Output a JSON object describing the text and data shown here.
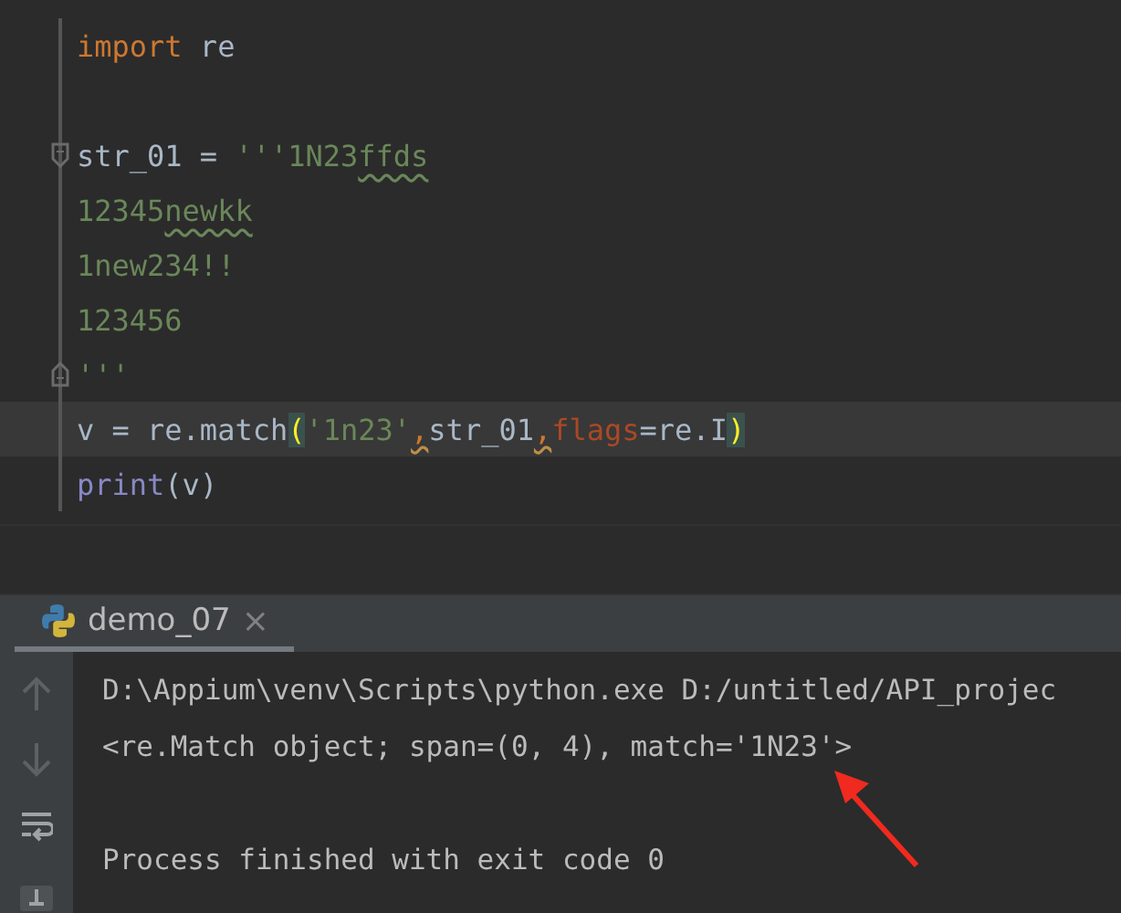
{
  "editor": {
    "lines": [
      {
        "kind": "plain",
        "current": false,
        "tokens": [
          {
            "text": "import",
            "kind": "keyword"
          },
          {
            "text": " re",
            "kind": "plain"
          }
        ]
      },
      {
        "kind": "blank"
      },
      {
        "kind": "fold-start",
        "current": false,
        "tokens": [
          {
            "text": "str_01 = ",
            "kind": "plain"
          },
          {
            "text": "'''1N23",
            "kind": "string"
          },
          {
            "text": "ffds",
            "kind": "typo"
          }
        ]
      },
      {
        "kind": "plain",
        "current": false,
        "tokens": [
          {
            "text": "12345",
            "kind": "string"
          },
          {
            "text": "newkk",
            "kind": "typo"
          }
        ]
      },
      {
        "kind": "plain",
        "current": false,
        "tokens": [
          {
            "text": "1new234!!",
            "kind": "string"
          }
        ]
      },
      {
        "kind": "plain",
        "current": false,
        "tokens": [
          {
            "text": "123456",
            "kind": "string"
          }
        ]
      },
      {
        "kind": "fold-end",
        "current": false,
        "tokens": [
          {
            "text": "'''",
            "kind": "string"
          }
        ]
      },
      {
        "kind": "plain",
        "current": true,
        "tokens": [
          {
            "text": "v = re.match",
            "kind": "plain"
          },
          {
            "text": "(",
            "kind": "brace"
          },
          {
            "text": "'1n23'",
            "kind": "string"
          },
          {
            "text": ",",
            "kind": "warn"
          },
          {
            "text": "str_01",
            "kind": "plain"
          },
          {
            "text": ",",
            "kind": "warn"
          },
          {
            "text": "flags",
            "kind": "param"
          },
          {
            "text": "=re.I",
            "kind": "plain"
          },
          {
            "text": ")",
            "kind": "brace"
          }
        ]
      },
      {
        "kind": "plain",
        "current": false,
        "tokens": [
          {
            "text": "print",
            "kind": "builtin"
          },
          {
            "text": "(v)",
            "kind": "plain"
          }
        ]
      }
    ]
  },
  "run_panel": {
    "tabs": [
      {
        "label": "demo_07",
        "selected": true,
        "close": "×"
      }
    ],
    "output": [
      {
        "kind": "text",
        "text": "D:\\Appium\\venv\\Scripts\\python.exe D:/untitled/API_projec"
      },
      {
        "kind": "text",
        "text": "<re.Match object; span=(0, 4), match='1N23'>"
      },
      {
        "kind": "blank"
      },
      {
        "kind": "text",
        "text": "Process finished with exit code 0"
      }
    ]
  }
}
